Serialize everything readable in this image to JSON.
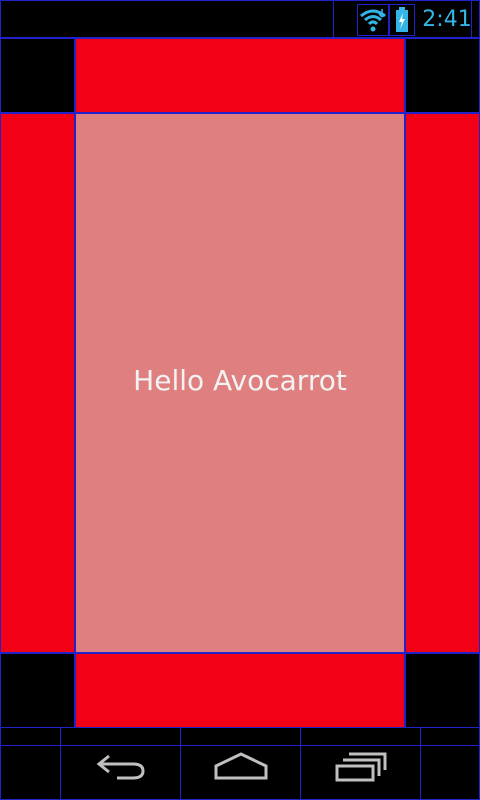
{
  "status_bar": {
    "time": "2:41",
    "icons": [
      "wifi-icon",
      "battery-charging-icon"
    ]
  },
  "main": {
    "greeting": "Hello Avocarrot"
  },
  "nav_bar": {
    "icons": [
      "back-icon",
      "home-icon",
      "recent-apps-icon"
    ]
  },
  "colors": {
    "frame_red": "#f20016",
    "center_panel": "#df7f80",
    "grid_lines": "#2222cc",
    "status_accent": "#33b5e5"
  }
}
